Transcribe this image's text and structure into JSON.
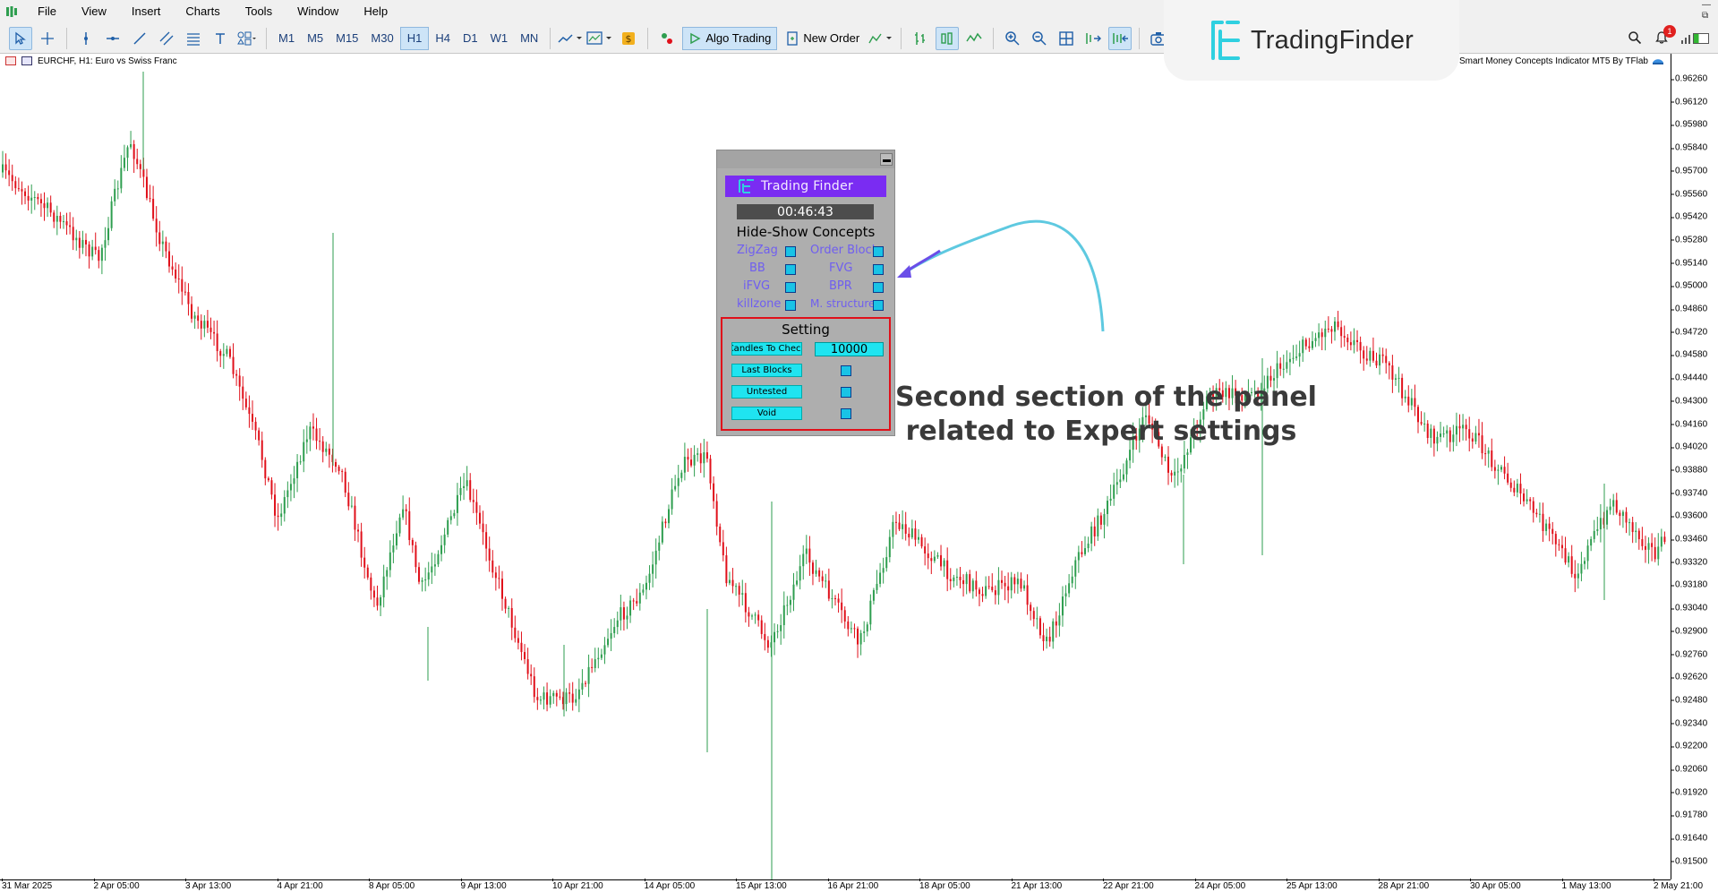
{
  "menu": {
    "items": [
      "File",
      "View",
      "Insert",
      "Charts",
      "Tools",
      "Window",
      "Help"
    ]
  },
  "toolbar": {
    "timeframes": [
      "M1",
      "M5",
      "M15",
      "M30",
      "H1",
      "H4",
      "D1",
      "W1",
      "MN"
    ],
    "active_timeframe": "H1",
    "algo_trading_label": "Algo Trading",
    "new_order_label": "New Order",
    "notification_count": "1"
  },
  "brand": {
    "name": "TradingFinder",
    "accent": "#2fd0e0"
  },
  "chart": {
    "title": "EURCHF, H1:  Euro vs Swiss Franc",
    "indicator_name": "Smart Money Concepts Indicator MT5 By TFlab",
    "up_color": "#2e9e4f",
    "down_color": "#e0101a",
    "price_labels": [
      "0.96260",
      "0.96120",
      "0.95980",
      "0.95840",
      "0.95700",
      "0.95560",
      "0.95420",
      "0.95280",
      "0.95140",
      "0.95000",
      "0.94860",
      "0.94720",
      "0.94580",
      "0.94440",
      "0.94300",
      "0.94160",
      "0.94020",
      "0.93880",
      "0.93740",
      "0.93600",
      "0.93460",
      "0.93320",
      "0.93180",
      "0.93040",
      "0.92900",
      "0.92760",
      "0.92620",
      "0.92480",
      "0.92340",
      "0.92200",
      "0.92060",
      "0.91920",
      "0.91780",
      "0.91640",
      "0.91500"
    ],
    "time_labels": [
      "31 Mar 2025",
      "2 Apr 05:00",
      "3 Apr 13:00",
      "4 Apr 21:00",
      "8 Apr 05:00",
      "9 Apr 13:00",
      "10 Apr 21:00",
      "14 Apr 05:00",
      "15 Apr 13:00",
      "16 Apr 21:00",
      "18 Apr 05:00",
      "21 Apr 13:00",
      "22 Apr 21:00",
      "24 Apr 05:00",
      "25 Apr 13:00",
      "28 Apr 21:00",
      "30 Apr 05:00",
      "1 May 13:00",
      "2 May 21:00"
    ]
  },
  "panel": {
    "logo_text": "Trading Finder",
    "timer": "00:46:43",
    "concepts_heading": "Hide-Show Concepts",
    "concepts": [
      {
        "left": "ZigZag",
        "right": "Order Block"
      },
      {
        "left": "BB",
        "right": "FVG"
      },
      {
        "left": "iFVG",
        "right": "BPR"
      },
      {
        "left": "killzone",
        "right": "M. structure"
      }
    ],
    "setting_heading": "Setting",
    "settings": [
      {
        "label": "Candles To Check",
        "value": "10000"
      },
      {
        "label": "Last Blocks"
      },
      {
        "label": "Untested"
      },
      {
        "label": "Void"
      }
    ]
  },
  "annotation": {
    "line1": "Second section of the panel",
    "line2": "related to Expert settings",
    "arrow_color": "#5ec9e0",
    "arrow_head_color": "#6a4ee8"
  }
}
